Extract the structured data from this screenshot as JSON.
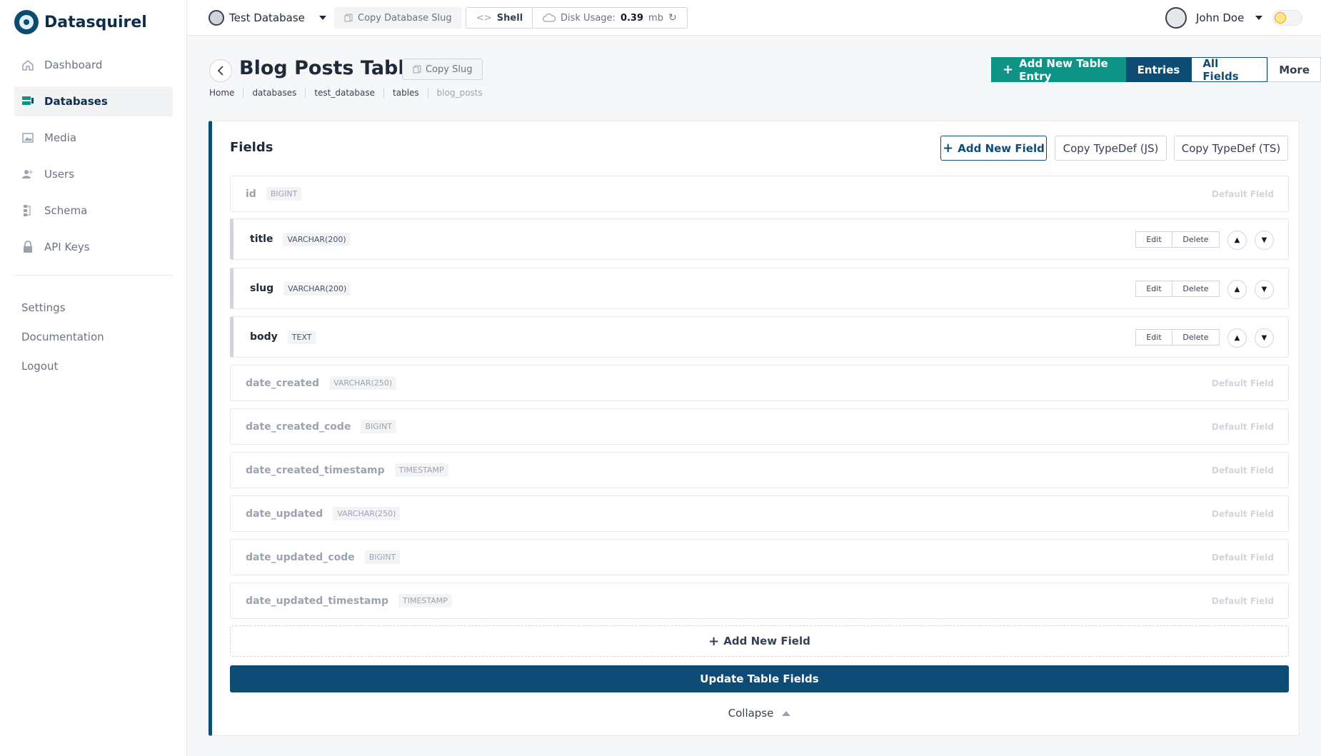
{
  "app": {
    "name": "Datasquirel"
  },
  "sidebar": {
    "items": [
      {
        "label": "Dashboard",
        "icon": "home-icon"
      },
      {
        "label": "Databases",
        "icon": "database-icon",
        "active": true
      },
      {
        "label": "Media",
        "icon": "image-icon"
      },
      {
        "label": "Users",
        "icon": "users-icon"
      },
      {
        "label": "Schema",
        "icon": "schema-icon"
      },
      {
        "label": "API Keys",
        "icon": "lock-icon"
      }
    ],
    "secondary": [
      "Settings",
      "Documentation",
      "Logout"
    ]
  },
  "topbar": {
    "database": "Test Database",
    "copy_slug": "Copy Database Slug",
    "shell": "Shell",
    "disk_label": "Disk Usage:",
    "disk_value": "0.39",
    "disk_unit": "mb",
    "user": "John Doe"
  },
  "page": {
    "title": "Blog Posts Table",
    "copy_slug": "Copy Slug",
    "breadcrumbs": [
      "Home",
      "databases",
      "test_database",
      "tables",
      "blog_posts"
    ],
    "actions": {
      "add_entry": "Add New Table Entry",
      "entries": "Entries",
      "all_fields": "All Fields",
      "more": "More"
    }
  },
  "fields_card": {
    "title": "Fields",
    "add_field": "Add New Field",
    "copy_js": "Copy TypeDef (JS)",
    "copy_ts": "Copy TypeDef (TS)",
    "default_label": "Default Field",
    "edit_label": "Edit",
    "delete_label": "Delete",
    "fields": [
      {
        "name": "id",
        "type": "BIGINT",
        "editable": false
      },
      {
        "name": "title",
        "type": "VARCHAR(200)",
        "editable": true
      },
      {
        "name": "slug",
        "type": "VARCHAR(200)",
        "editable": true
      },
      {
        "name": "body",
        "type": "TEXT",
        "editable": true
      },
      {
        "name": "date_created",
        "type": "VARCHAR(250)",
        "editable": false
      },
      {
        "name": "date_created_code",
        "type": "BIGINT",
        "editable": false
      },
      {
        "name": "date_created_timestamp",
        "type": "TIMESTAMP",
        "editable": false
      },
      {
        "name": "date_updated",
        "type": "VARCHAR(250)",
        "editable": false
      },
      {
        "name": "date_updated_code",
        "type": "BIGINT",
        "editable": false
      },
      {
        "name": "date_updated_timestamp",
        "type": "TIMESTAMP",
        "editable": false
      }
    ],
    "add_field_bottom": "Add New Field",
    "update_button": "Update Table Fields",
    "collapse": "Collapse"
  },
  "colors": {
    "primary": "#0f4c75",
    "accent": "#0e9384"
  }
}
